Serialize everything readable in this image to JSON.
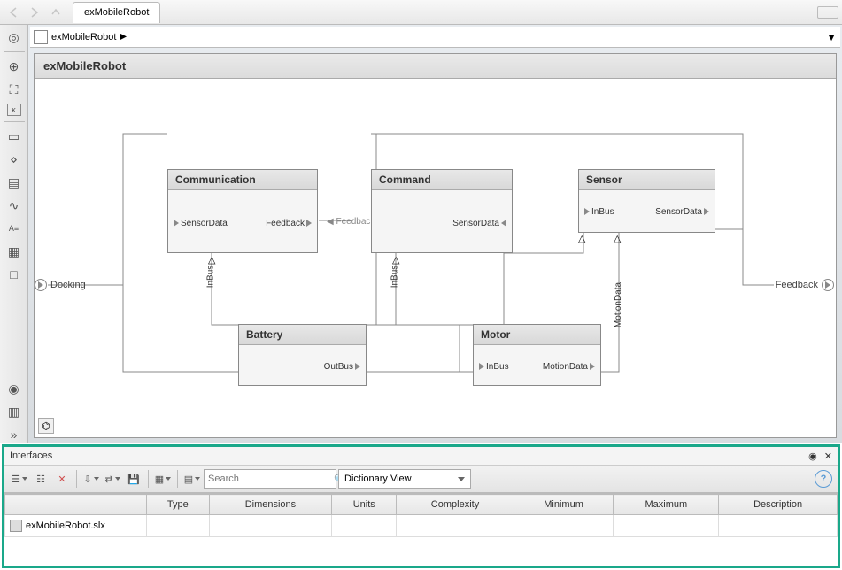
{
  "tab": {
    "title": "exMobileRobot"
  },
  "breadcrumb": {
    "name": "exMobileRobot"
  },
  "model": {
    "title": "exMobileRobot"
  },
  "blocks": {
    "communication": {
      "title": "Communication",
      "ports": {
        "sensordata": "SensorData",
        "feedback": "Feedback",
        "inbus": "InBus"
      }
    },
    "command": {
      "title": "Command",
      "ports": {
        "sensordata": "SensorData",
        "inbus": "InBus"
      }
    },
    "sensor": {
      "title": "Sensor",
      "ports": {
        "inbus": "InBus",
        "sensordata": "SensorData",
        "motiondata": "MotionData"
      }
    },
    "battery": {
      "title": "Battery",
      "ports": {
        "outbus": "OutBus"
      }
    },
    "motor": {
      "title": "Motor",
      "ports": {
        "inbus": "InBus",
        "motiondata": "MotionData"
      }
    }
  },
  "external": {
    "docking": "Docking",
    "feedback": "Feedback",
    "feedback_ext": "Feedback"
  },
  "interfaces": {
    "title": "Interfaces",
    "search_placeholder": "Search",
    "view": "Dictionary View",
    "columns": {
      "first": "",
      "type": "Type",
      "dimensions": "Dimensions",
      "units": "Units",
      "complexity": "Complexity",
      "minimum": "Minimum",
      "maximum": "Maximum",
      "description": "Description"
    },
    "row": {
      "file": "exMobileRobot.slx"
    }
  }
}
